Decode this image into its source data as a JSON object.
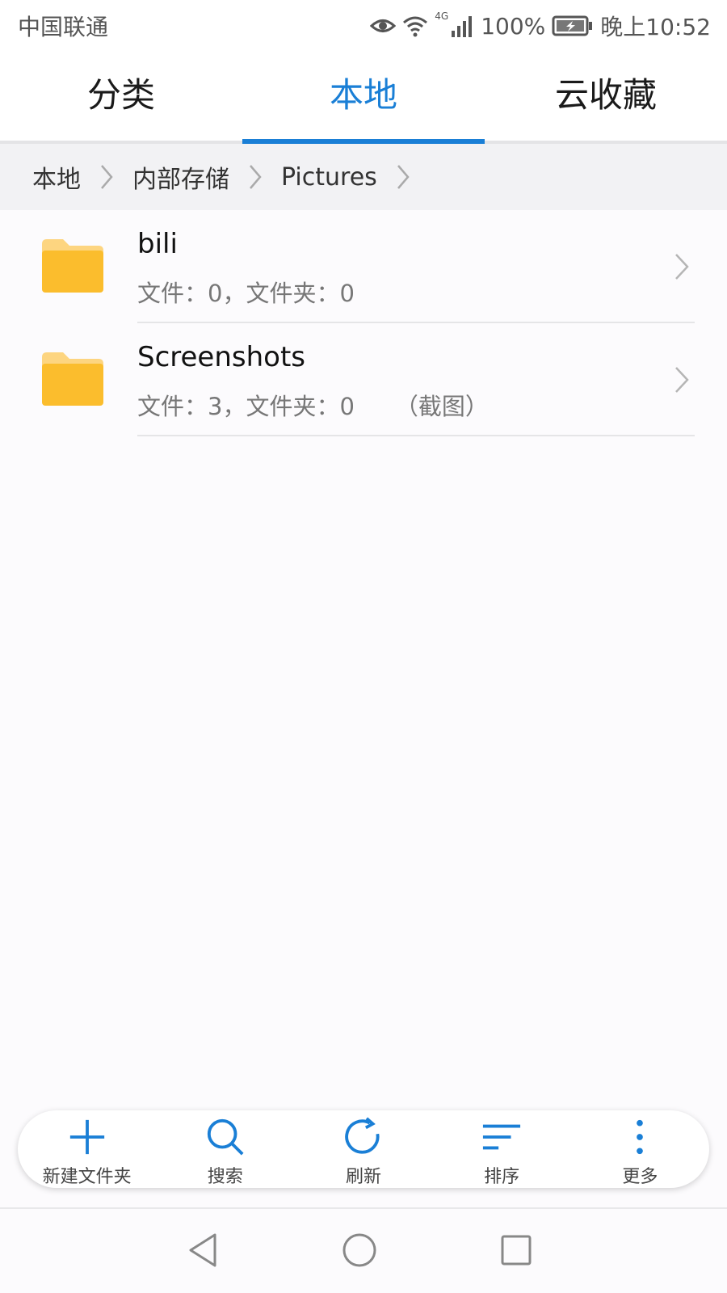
{
  "status_bar": {
    "carrier": "中国联通",
    "network_type": "4G",
    "battery": "100%",
    "time": "晚上10:52",
    "icons": [
      "eye-icon",
      "wifi-icon",
      "signal-icon",
      "battery-charging-icon"
    ]
  },
  "tabs": [
    {
      "label": "分类",
      "active": false
    },
    {
      "label": "本地",
      "active": true
    },
    {
      "label": "云收藏",
      "active": false
    }
  ],
  "breadcrumb": {
    "items": [
      "本地",
      "内部存储",
      "Pictures"
    ]
  },
  "files": [
    {
      "name": "bili",
      "meta": "文件：0，文件夹：0",
      "tag": "",
      "icon": "folder-icon"
    },
    {
      "name": "Screenshots",
      "meta": "文件：3，文件夹：0",
      "tag": "（截图）",
      "icon": "folder-icon"
    }
  ],
  "toolbar": {
    "new_folder": "新建文件夹",
    "search": "搜索",
    "refresh": "刷新",
    "sort": "排序",
    "more": "更多"
  },
  "colors": {
    "accent": "#1a7fd6",
    "folder": "#fbbd2d",
    "folder_tab": "#fdd580"
  }
}
